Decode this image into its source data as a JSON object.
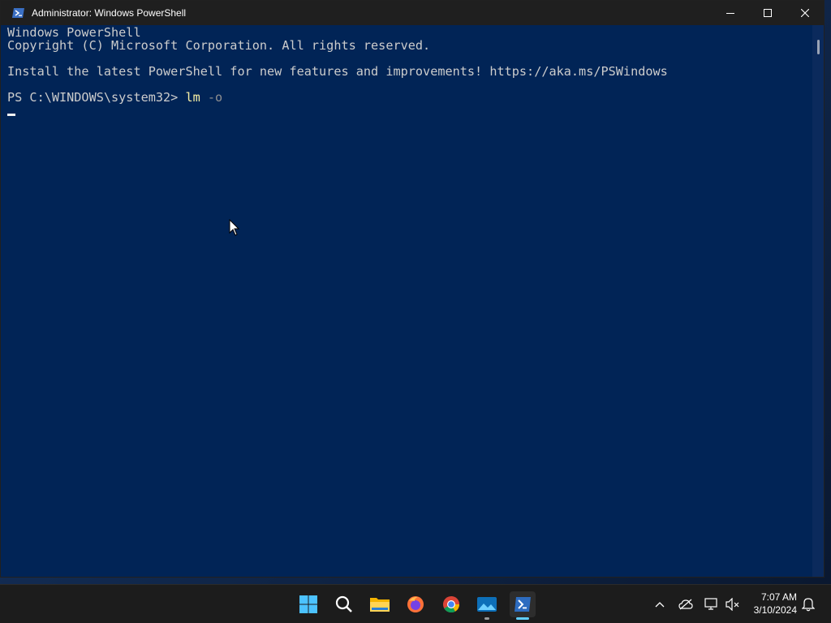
{
  "window": {
    "title": "Administrator: Windows PowerShell"
  },
  "console": {
    "line1": "Windows PowerShell",
    "line2": "Copyright (C) Microsoft Corporation. All rights reserved.",
    "line3": "Install the latest PowerShell for new features and improvements! https://aka.ms/PSWindows",
    "prompt": "PS C:\\WINDOWS\\system32> ",
    "command": "lm",
    "parameter": " -o"
  },
  "taskbar": {
    "icons": [
      "start-icon",
      "search-icon",
      "file-explorer-icon",
      "firefox-icon",
      "chrome-icon",
      "photos-icon",
      "powershell-icon"
    ],
    "tray_icons": [
      "chevron-up-icon",
      "onedrive-icon",
      "network-icon",
      "volume-muted-icon",
      "notifications-icon"
    ],
    "clock": {
      "time": "7:07 AM",
      "date": "3/10/2024"
    }
  },
  "colors": {
    "console_bg": "#012456",
    "titlebar_bg": "#1f1f1f",
    "taskbar_bg": "#1c1c1c",
    "accent": "#60cdff"
  }
}
